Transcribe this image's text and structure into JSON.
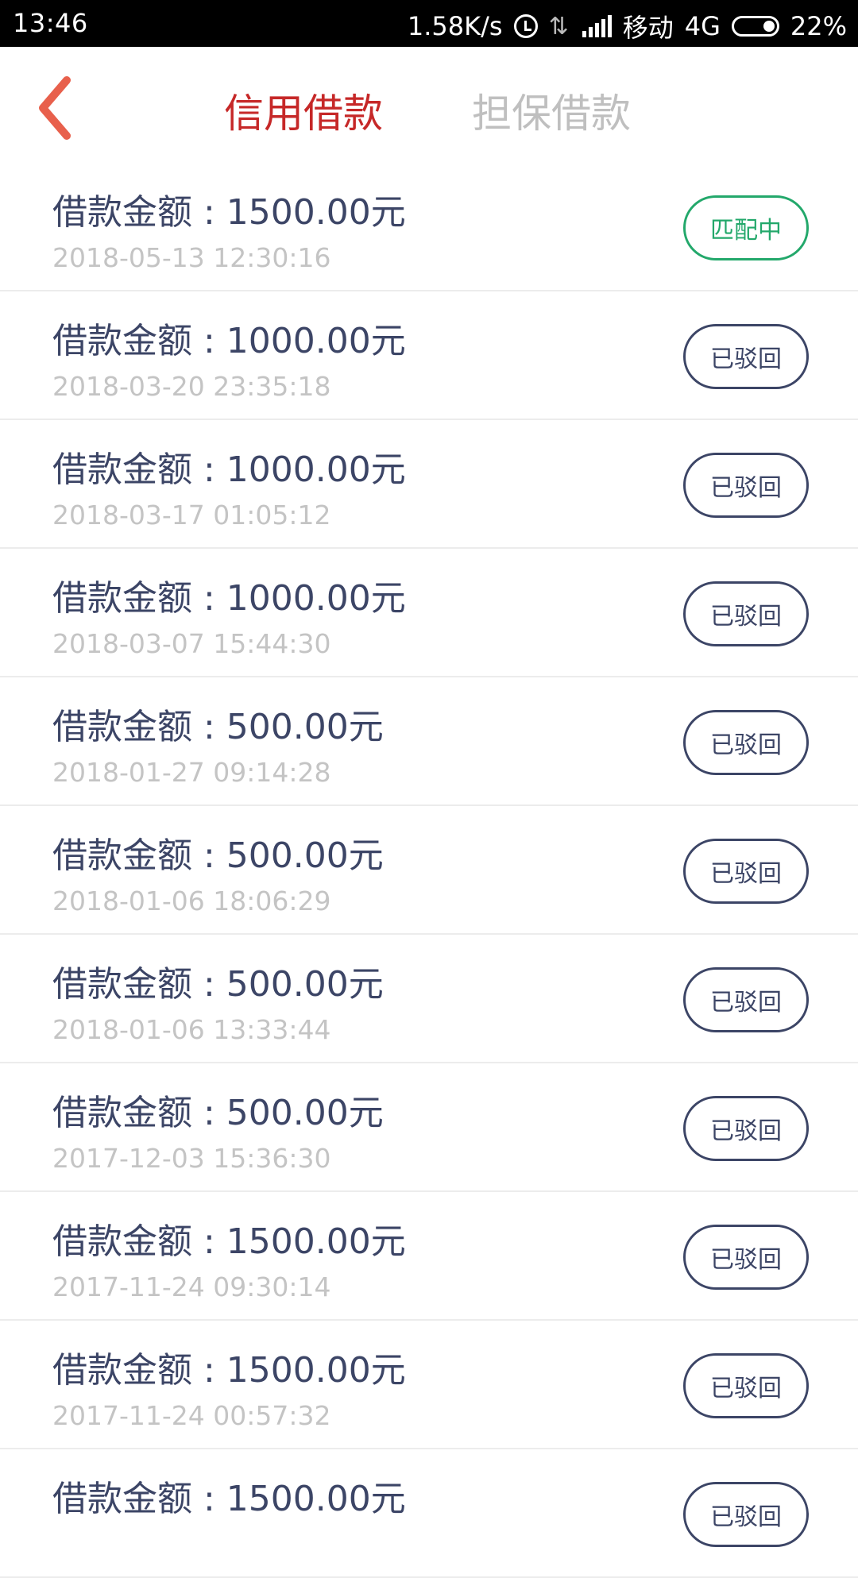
{
  "status_bar": {
    "time": "13:46",
    "speed": "1.58K/s",
    "carrier": "移动",
    "network": "4G",
    "battery": "22%"
  },
  "header": {
    "tabs": [
      {
        "label": "信用借款",
        "active": true
      },
      {
        "label": "担保借款",
        "active": false
      }
    ]
  },
  "loans": [
    {
      "title": "借款金额 : 1500.00元",
      "time": "2018-05-13 12:30:16",
      "status": "匹配中",
      "state": "matching"
    },
    {
      "title": "借款金额 : 1000.00元",
      "time": "2018-03-20 23:35:18",
      "status": "已驳回",
      "state": "rejected"
    },
    {
      "title": "借款金额 : 1000.00元",
      "time": "2018-03-17 01:05:12",
      "status": "已驳回",
      "state": "rejected"
    },
    {
      "title": "借款金额 : 1000.00元",
      "time": "2018-03-07 15:44:30",
      "status": "已驳回",
      "state": "rejected"
    },
    {
      "title": "借款金额 : 500.00元",
      "time": "2018-01-27 09:14:28",
      "status": "已驳回",
      "state": "rejected"
    },
    {
      "title": "借款金额 : 500.00元",
      "time": "2018-01-06 18:06:29",
      "status": "已驳回",
      "state": "rejected"
    },
    {
      "title": "借款金额 : 500.00元",
      "time": "2018-01-06 13:33:44",
      "status": "已驳回",
      "state": "rejected"
    },
    {
      "title": "借款金额 : 500.00元",
      "time": "2017-12-03 15:36:30",
      "status": "已驳回",
      "state": "rejected"
    },
    {
      "title": "借款金额 : 1500.00元",
      "time": "2017-11-24 09:30:14",
      "status": "已驳回",
      "state": "rejected"
    },
    {
      "title": "借款金额 : 1500.00元",
      "time": "2017-11-24 00:57:32",
      "status": "已驳回",
      "state": "rejected"
    },
    {
      "title": "借款金额 : 1500.00元",
      "time": "",
      "status": "已驳回",
      "state": "rejected"
    }
  ],
  "colors": {
    "accent_red": "#c62828",
    "text_dark": "#3c4566",
    "matching_green": "#23a86b"
  }
}
